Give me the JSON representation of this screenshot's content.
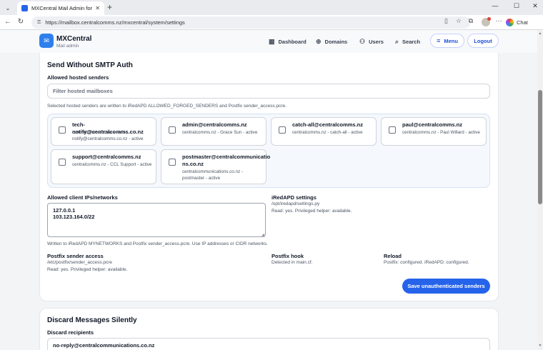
{
  "browser": {
    "tab_title": "MXCentral Mail Admin for CCL",
    "url": "https://mailbox.centralcomms.nz/mxcentral/system/settings",
    "chat_label": "Chat"
  },
  "app": {
    "brand": "MXCentral",
    "brand_sub": "Mail admin",
    "nav": {
      "dashboard": "Dashboard",
      "domains": "Domains",
      "users": "Users",
      "search": "Search",
      "menu": "Menu",
      "logout": "Logout"
    }
  },
  "smtp": {
    "title": "Send Without SMTP Auth",
    "senders_label": "Allowed hosted senders",
    "filter_placeholder": "Filter hosted mailboxes",
    "senders_help": "Selected hosted senders are written to iRedAPD ALLOWED_FORGED_SENDERS and Postfix sender_access.pcre.",
    "senders": [
      {
        "address": "tech-notify@centralcomms.co.nz",
        "meta1": "centralcomms.co.nz - tech-",
        "meta2": "notify@centralcomms.co.nz - active"
      },
      {
        "address": "admin@centralcomms.nz",
        "meta1": "centralcomms.nz - Grace Sun - active",
        "meta2": ""
      },
      {
        "address": "catch-all@centralcomms.nz",
        "meta1": "centralcomms.nz - catch-all - active",
        "meta2": ""
      },
      {
        "address": "paul@centralcomms.nz",
        "meta1": "centralcomms.nz - Paul Willard - active",
        "meta2": ""
      },
      {
        "address": "support@centralcomms.nz",
        "meta1": "centralcomms.nz - CCL Support - active",
        "meta2": ""
      },
      {
        "address_l1": "postmaster@centralcommunicatio",
        "address_l2": "ns.co.nz",
        "meta1": "centralcommunications.co.nz -",
        "meta2": "postmaster - active"
      }
    ],
    "ips_label": "Allowed client IPs/networks",
    "ips_value": "127.0.0.1\n103.123.164.0/22",
    "ips_help": "Written to iRedAPD MYNETWORKS and Postfix sender_access.pcre. Use IP addresses or CIDR networks.",
    "iredapd": {
      "title": "iRedAPD settings",
      "path": "/opt/iredapd/settings.py",
      "status": "Read: yes. Privileged helper: available."
    },
    "postfix_access": {
      "title": "Postfix sender access",
      "path": "/etc/postfix/sender_access.pcre",
      "status": "Read: yes. Privileged helper: available."
    },
    "postfix_hook": {
      "title": "Postfix hook",
      "status": "Detected in main.cf."
    },
    "reload": {
      "title": "Reload",
      "status": "Postfix: configured. iRedAPD: configured."
    },
    "save_label": "Save unauthenticated senders"
  },
  "discard": {
    "title": "Discard Messages Silently",
    "recipients_label": "Discard recipients",
    "recipients_value": "no-reply@centralcommunications.co.nz"
  }
}
